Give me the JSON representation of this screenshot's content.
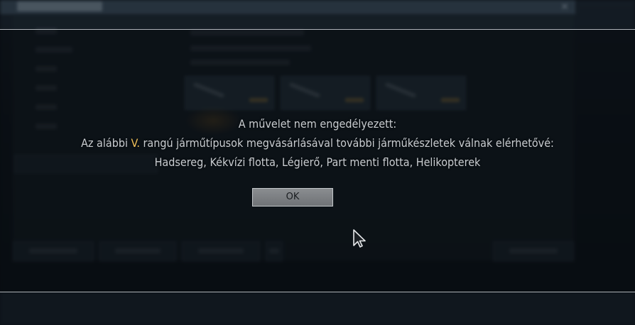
{
  "dialog": {
    "line1": "A művelet nem engedélyezett:",
    "line2_before": "Az alábbi ",
    "line2_rank": "V.",
    "line2_after": " rangú járműtípusok megvásárlásával további járműkészletek válnak elérhetővé:",
    "line3": "Hadsereg, Kékvízi flotta, Légierő, Part menti flotta, Helikopterek",
    "ok_label": "OK"
  },
  "colors": {
    "rank_highlight": "#f0c15a",
    "text": "#c9cdd1",
    "button_bg": "#7d8084",
    "divider": "#aeb3b8"
  },
  "icons": {
    "cursor": "arrow-cursor-icon",
    "close": "close-icon"
  }
}
